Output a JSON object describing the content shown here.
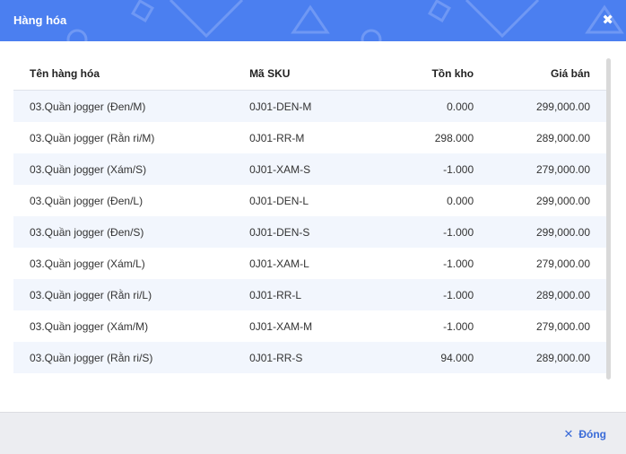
{
  "dialog": {
    "title": "Hàng hóa",
    "close_icon": "close-icon",
    "close_glyph": "✖"
  },
  "table": {
    "headers": [
      "Tên hàng hóa",
      "Mã SKU",
      "Tồn kho",
      "Giá bán"
    ],
    "rows": [
      {
        "name": "03.Quần jogger (Đen/M)",
        "sku": "0J01-DEN-M",
        "stock": "0.000",
        "price": "299,000.00"
      },
      {
        "name": "03.Quần jogger (Rằn ri/M)",
        "sku": "0J01-RR-M",
        "stock": "298.000",
        "price": "289,000.00"
      },
      {
        "name": "03.Quần jogger (Xám/S)",
        "sku": "0J01-XAM-S",
        "stock": "-1.000",
        "price": "279,000.00"
      },
      {
        "name": "03.Quần jogger (Đen/L)",
        "sku": "0J01-DEN-L",
        "stock": "0.000",
        "price": "299,000.00"
      },
      {
        "name": "03.Quần jogger (Đen/S)",
        "sku": "0J01-DEN-S",
        "stock": "-1.000",
        "price": "299,000.00"
      },
      {
        "name": "03.Quần jogger (Xám/L)",
        "sku": "0J01-XAM-L",
        "stock": "-1.000",
        "price": "279,000.00"
      },
      {
        "name": "03.Quần jogger (Rằn ri/L)",
        "sku": "0J01-RR-L",
        "stock": "-1.000",
        "price": "289,000.00"
      },
      {
        "name": "03.Quần jogger (Xám/M)",
        "sku": "0J01-XAM-M",
        "stock": "-1.000",
        "price": "279,000.00"
      },
      {
        "name": "03.Quần jogger (Rằn ri/S)",
        "sku": "0J01-RR-S",
        "stock": "94.000",
        "price": "289,000.00"
      }
    ]
  },
  "footer": {
    "close_label": "Đóng",
    "close_glyph": "✕",
    "close_icon": "close-icon"
  },
  "colors": {
    "header_bg": "#4b7ff0",
    "row_stripe": "#f2f6fd",
    "footer_bg": "#ecedf1",
    "accent": "#3a6bd8"
  }
}
